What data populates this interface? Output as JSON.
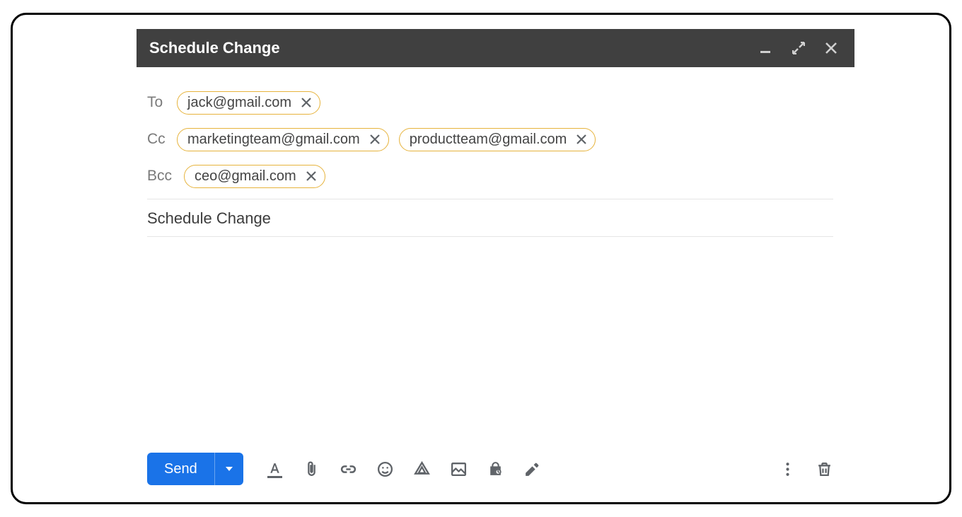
{
  "header": {
    "title": "Schedule Change"
  },
  "fields": {
    "to_label": "To",
    "cc_label": "Cc",
    "bcc_label": "Bcc",
    "to": [
      "jack@gmail.com"
    ],
    "cc": [
      "marketingteam@gmail.com",
      "productteam@gmail.com"
    ],
    "bcc": [
      "ceo@gmail.com"
    ]
  },
  "subject": "Schedule Change",
  "toolbar": {
    "send_label": "Send"
  },
  "colors": {
    "accent": "#1a73e8",
    "chip_border": "#e6b33c",
    "header_bg": "#404040"
  }
}
